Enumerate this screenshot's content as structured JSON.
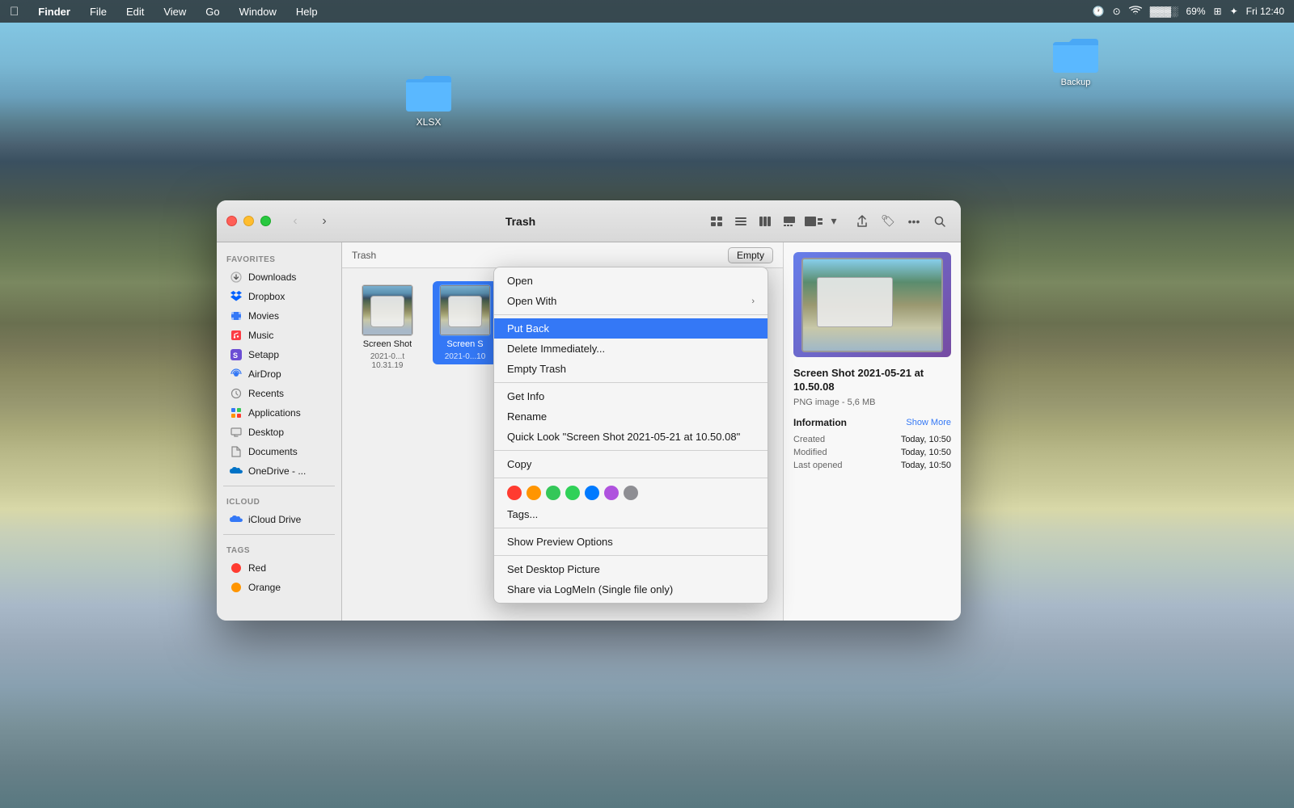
{
  "menubar": {
    "apple": "⌘",
    "finder": "Finder",
    "file": "File",
    "edit": "Edit",
    "view": "View",
    "go": "Go",
    "window": "Window",
    "help": "Help",
    "time_icon": "🕐",
    "battery": "69%",
    "date_time": "Fri 12:40"
  },
  "desktop": {
    "xlsx_folder_label": "XLSX",
    "backup_folder_label": "Backup"
  },
  "finder": {
    "title": "Trash",
    "path_label": "Trash",
    "empty_button": "Empty",
    "nav_back": "‹",
    "nav_forward": "›",
    "sidebar": {
      "favorites_header": "Favorites",
      "items": [
        {
          "id": "downloads",
          "label": "Downloads",
          "icon": "⬇"
        },
        {
          "id": "dropbox",
          "label": "Dropbox",
          "icon": "📦"
        },
        {
          "id": "movies",
          "label": "Movies",
          "icon": "🎬"
        },
        {
          "id": "music",
          "label": "Music",
          "icon": "🎵"
        },
        {
          "id": "setapp",
          "label": "Setapp",
          "icon": "🅢"
        },
        {
          "id": "airdrop",
          "label": "AirDrop",
          "icon": "📡"
        },
        {
          "id": "recents",
          "label": "Recents",
          "icon": "🕐"
        },
        {
          "id": "applications",
          "label": "Applications",
          "icon": "📱"
        },
        {
          "id": "desktop",
          "label": "Desktop",
          "icon": "🖥"
        },
        {
          "id": "documents",
          "label": "Documents",
          "icon": "📄"
        },
        {
          "id": "onedrive",
          "label": "OneDrive - ...",
          "icon": "☁"
        }
      ],
      "icloud_header": "iCloud",
      "icloud_items": [
        {
          "id": "icloud-drive",
          "label": "iCloud Drive",
          "icon": "☁"
        }
      ],
      "tags_header": "Tags",
      "tags": [
        {
          "id": "red",
          "label": "Red",
          "color": "#ff3b30"
        },
        {
          "id": "orange",
          "label": "Orange",
          "color": "#ff9500"
        }
      ]
    },
    "files": [
      {
        "id": "screenshot1",
        "name": "Screen Shot",
        "date": "2021-0...t 10.31.19",
        "selected": false
      },
      {
        "id": "screenshot2",
        "name": "Screen S",
        "date": "2021-0...10",
        "selected": true
      }
    ],
    "preview": {
      "filename": "Screen Shot 2021-05-21 at 10.50.08",
      "filetype": "PNG image - 5,6 MB",
      "info_title": "Information",
      "show_more": "Show More",
      "created_label": "Created",
      "created_value": "Today, 10:50",
      "modified_label": "Modified",
      "modified_value": "Today, 10:50",
      "last_opened_label": "Last opened",
      "last_opened_value": "Today, 10:50"
    }
  },
  "context_menu": {
    "items": [
      {
        "id": "open",
        "label": "Open",
        "has_arrow": false
      },
      {
        "id": "open-with",
        "label": "Open With",
        "has_arrow": true
      },
      {
        "id": "put-back",
        "label": "Put Back",
        "has_arrow": false,
        "highlighted": true
      },
      {
        "id": "delete-immediately",
        "label": "Delete Immediately...",
        "has_arrow": false
      },
      {
        "id": "empty-trash",
        "label": "Empty Trash",
        "has_arrow": false
      },
      {
        "id": "get-info",
        "label": "Get Info",
        "has_arrow": false
      },
      {
        "id": "rename",
        "label": "Rename",
        "has_arrow": false
      },
      {
        "id": "quick-look",
        "label": "Quick Look \"Screen Shot 2021-05-21 at 10.50.08\"",
        "has_arrow": false
      },
      {
        "id": "copy",
        "label": "Copy",
        "has_arrow": false
      },
      {
        "id": "show-preview-options",
        "label": "Show Preview Options",
        "has_arrow": false
      },
      {
        "id": "set-desktop-picture",
        "label": "Set Desktop Picture",
        "has_arrow": false
      },
      {
        "id": "share-logmein",
        "label": "Share via LogMeIn (Single file only)",
        "has_arrow": false
      }
    ],
    "tags_label": "Tags...",
    "tag_colors": [
      "#ff3b30",
      "#ff9500",
      "#34c759",
      "#30d158",
      "#007aff",
      "#af52de",
      "#8e8e93"
    ]
  }
}
